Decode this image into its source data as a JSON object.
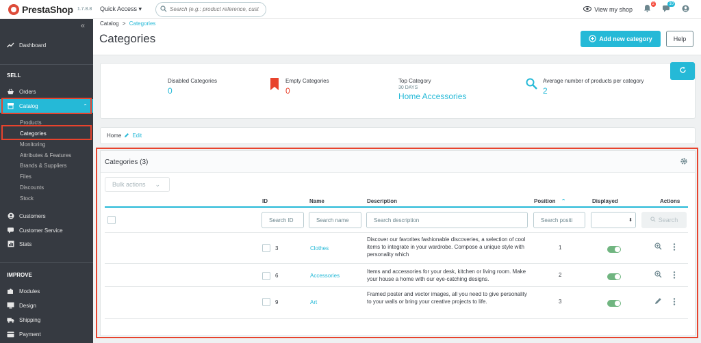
{
  "header": {
    "logo_text": "PrestaShop",
    "version": "1.7.8.8",
    "quick_access": "Quick Access ▾",
    "search_placeholder": "Search (e.g.: product reference, custon",
    "view_shop": "View my shop",
    "notif_orders_count": "2",
    "notif_customers_count": "10"
  },
  "sidebar": {
    "collapse_icon": "«",
    "dashboard": "Dashboard",
    "sell_section": "SELL",
    "orders": "Orders",
    "catalog": "Catalog",
    "catalog_sub": [
      "Products",
      "Categories",
      "Monitoring",
      "Attributes & Features",
      "Brands & Suppliers",
      "Files",
      "Discounts",
      "Stock"
    ],
    "customers": "Customers",
    "customer_service": "Customer Service",
    "stats": "Stats",
    "improve_section": "IMPROVE",
    "modules": "Modules",
    "design": "Design",
    "shipping": "Shipping",
    "payment": "Payment"
  },
  "breadcrumb": {
    "parent": "Catalog",
    "sep": ">",
    "current": "Categories"
  },
  "page_title": "Categories",
  "toolbar": {
    "add_label": "Add new category",
    "help_label": "Help"
  },
  "kpis": [
    {
      "label": "Disabled Categories",
      "value": "0",
      "color": "#25b9d7"
    },
    {
      "label": "Empty Categories",
      "value": "0",
      "color": "#e8432d"
    },
    {
      "label": "Top Category",
      "sub": "30 DAYS",
      "value": "Home Accessories",
      "color": "#25b9d7"
    },
    {
      "label": "Average number of products per category",
      "value": "2",
      "color": "#25b9d7"
    }
  ],
  "home_bar": {
    "home": "Home",
    "edit": "Edit"
  },
  "panel": {
    "title": "Categories (3)",
    "bulk_actions": "Bulk actions",
    "columns": {
      "id": "ID",
      "name": "Name",
      "description": "Description",
      "position": "Position",
      "displayed": "Displayed",
      "actions": "Actions"
    },
    "filters": {
      "id": "Search ID",
      "name": "Search name",
      "description": "Search description",
      "position": "Search positi",
      "search_button": "Search"
    },
    "rows": [
      {
        "id": "3",
        "name": "Clothes",
        "description": "Discover our favorites fashionable discoveries, a selection of cool items to integrate in your wardrobe. Compose a unique style with personality which",
        "position": "1",
        "displayed": true,
        "action": "zoom"
      },
      {
        "id": "6",
        "name": "Accessories",
        "description": "Items and accessories for your desk, kitchen or living room. Make your house a home with our eye-catching designs.",
        "position": "2",
        "displayed": true,
        "action": "zoom"
      },
      {
        "id": "9",
        "name": "Art",
        "description": "Framed poster and vector images, all you need to give personality to your walls or bring your creative projects to life.",
        "position": "3",
        "displayed": true,
        "action": "edit"
      }
    ]
  },
  "colors": {
    "accent": "#25b9d7",
    "highlight": "#e8432d",
    "sidebar": "#363a41",
    "toggle_on": "#70b580"
  }
}
